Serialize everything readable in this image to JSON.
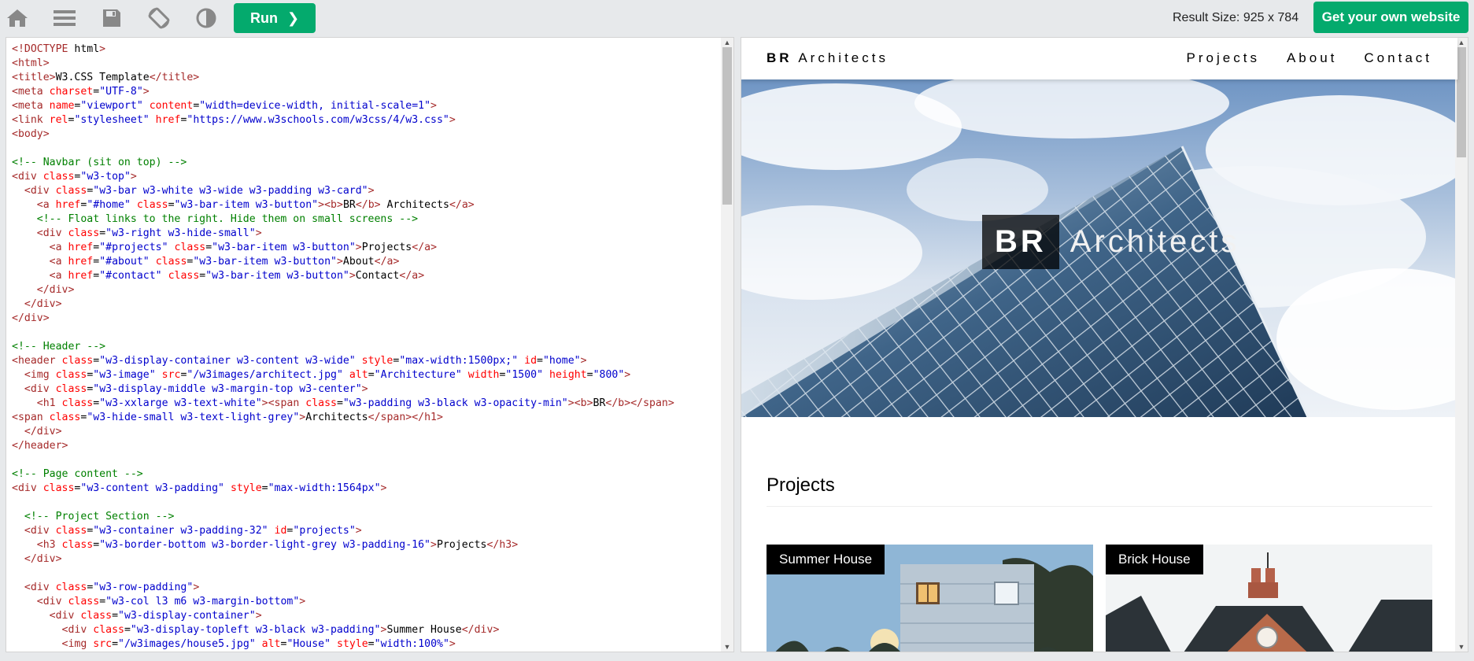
{
  "toolbar": {
    "icons": [
      "home-icon",
      "menu-icon",
      "save-icon",
      "rotate-icon",
      "theme-contrast-icon"
    ],
    "run_label": "Run",
    "result_size": "Result Size: 925 x 784",
    "get_website_label": "Get your own website",
    "accent": "#04aa6d"
  },
  "code_lines": [
    "<!DOCTYPE html>",
    "<html>",
    "<title>W3.CSS Template</title>",
    "<meta charset=\"UTF-8\">",
    "<meta name=\"viewport\" content=\"width=device-width, initial-scale=1\">",
    "<link rel=\"stylesheet\" href=\"https://www.w3schools.com/w3css/4/w3.css\">",
    "<body>",
    "",
    "<!-- Navbar (sit on top) -->",
    "<div class=\"w3-top\">",
    "  <div class=\"w3-bar w3-white w3-wide w3-padding w3-card\">",
    "    <a href=\"#home\" class=\"w3-bar-item w3-button\"><b>BR</b> Architects</a>",
    "    <!-- Float links to the right. Hide them on small screens -->",
    "    <div class=\"w3-right w3-hide-small\">",
    "      <a href=\"#projects\" class=\"w3-bar-item w3-button\">Projects</a>",
    "      <a href=\"#about\" class=\"w3-bar-item w3-button\">About</a>",
    "      <a href=\"#contact\" class=\"w3-bar-item w3-button\">Contact</a>",
    "    </div>",
    "  </div>",
    "</div>",
    "",
    "<!-- Header -->",
    "<header class=\"w3-display-container w3-content w3-wide\" style=\"max-width:1500px;\" id=\"home\">",
    "  <img class=\"w3-image\" src=\"/w3images/architect.jpg\" alt=\"Architecture\" width=\"1500\" height=\"800\">",
    "  <div class=\"w3-display-middle w3-margin-top w3-center\">",
    "    <h1 class=\"w3-xxlarge w3-text-white\"><span class=\"w3-padding w3-black w3-opacity-min\"><b>BR</b></span>",
    "<span class=\"w3-hide-small w3-text-light-grey\">Architects</span></h1>",
    "  </div>",
    "</header>",
    "",
    "<!-- Page content -->",
    "<div class=\"w3-content w3-padding\" style=\"max-width:1564px\">",
    "",
    "  <!-- Project Section -->",
    "  <div class=\"w3-container w3-padding-32\" id=\"projects\">",
    "    <h3 class=\"w3-border-bottom w3-border-light-grey w3-padding-16\">Projects</h3>",
    "  </div>",
    "",
    "  <div class=\"w3-row-padding\">",
    "    <div class=\"w3-col l3 m6 w3-margin-bottom\">",
    "      <div class=\"w3-display-container\">",
    "        <div class=\"w3-display-topleft w3-black w3-padding\">Summer House</div>",
    "        <img src=\"/w3images/house5.jpg\" alt=\"House\" style=\"width:100%\">"
  ],
  "result": {
    "brand_bold": "BR",
    "brand_rest": " Architects",
    "nav_links": [
      "Projects",
      "About",
      "Contact"
    ],
    "hero_bold": "BR",
    "hero_rest": "Architects",
    "section_title": "Projects",
    "cards": [
      {
        "label": "Summer House"
      },
      {
        "label": "Brick House"
      }
    ]
  }
}
